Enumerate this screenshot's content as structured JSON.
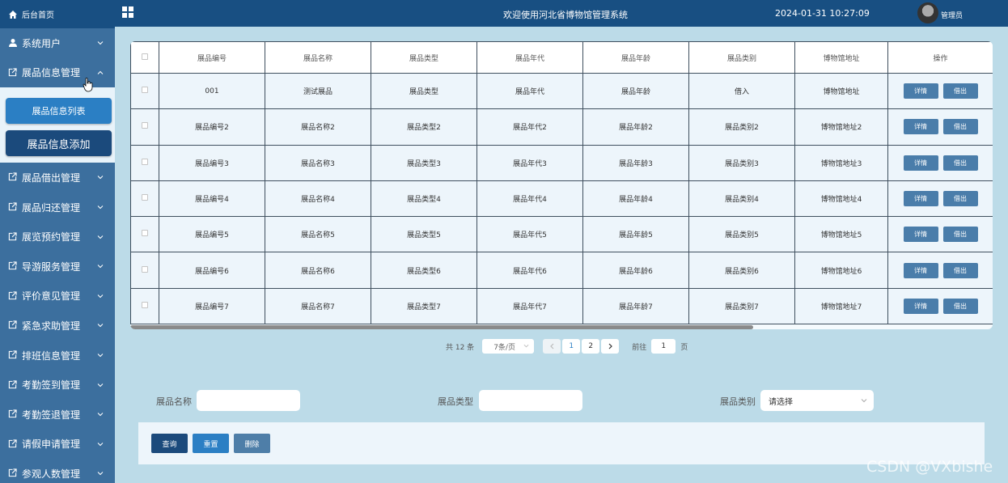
{
  "header": {
    "welcome": "欢迎使用河北省博物馆管理系统",
    "datetime": "2024-01-31 10:27:09",
    "user": "管理员"
  },
  "sidebar": {
    "home": "后台首页",
    "items": [
      {
        "label": "系统用户"
      },
      {
        "label": "展品信息管理",
        "expanded": true,
        "children": [
          "展品信息列表",
          "展品信息添加"
        ]
      },
      {
        "label": "展品借出管理"
      },
      {
        "label": "展品归还管理"
      },
      {
        "label": "展览预约管理"
      },
      {
        "label": "导游服务管理"
      },
      {
        "label": "评价意见管理"
      },
      {
        "label": "紧急求助管理"
      },
      {
        "label": "排班信息管理"
      },
      {
        "label": "考勤签到管理"
      },
      {
        "label": "考勤签退管理"
      },
      {
        "label": "请假申请管理"
      },
      {
        "label": "参观人数管理"
      }
    ]
  },
  "table": {
    "columns": [
      "展品编号",
      "展品名称",
      "展品类型",
      "展品年代",
      "展品年龄",
      "展品类别",
      "博物馆地址",
      "操作"
    ],
    "rows": [
      [
        "001",
        "测试展品",
        "展品类型",
        "展品年代",
        "展品年龄",
        "借入",
        "博物馆地址"
      ],
      [
        "展品编号2",
        "展品名称2",
        "展品类型2",
        "展品年代2",
        "展品年龄2",
        "展品类别2",
        "博物馆地址2"
      ],
      [
        "展品编号3",
        "展品名称3",
        "展品类型3",
        "展品年代3",
        "展品年龄3",
        "展品类别3",
        "博物馆地址3"
      ],
      [
        "展品编号4",
        "展品名称4",
        "展品类型4",
        "展品年代4",
        "展品年龄4",
        "展品类别4",
        "博物馆地址4"
      ],
      [
        "展品编号5",
        "展品名称5",
        "展品类型5",
        "展品年代5",
        "展品年龄5",
        "展品类别5",
        "博物馆地址5"
      ],
      [
        "展品编号6",
        "展品名称6",
        "展品类型6",
        "展品年代6",
        "展品年龄6",
        "展品类别6",
        "博物馆地址6"
      ],
      [
        "展品编号7",
        "展品名称7",
        "展品类型7",
        "展品年代7",
        "展品年龄7",
        "展品类别7",
        "博物馆地址7"
      ]
    ],
    "row_actions": [
      "详情",
      "借出"
    ]
  },
  "pagination": {
    "total": "共 12 条",
    "page_size": "7条/页",
    "pages": [
      "1",
      "2"
    ],
    "current": "1",
    "goto_label": "前往",
    "goto_value": "1",
    "page_unit": "页"
  },
  "search": {
    "name_label": "展品名称",
    "type_label": "展品类型",
    "category_label": "展品类别",
    "category_placeholder": "请选择"
  },
  "actions": {
    "query": "查询",
    "reset": "重置",
    "delete": "删除"
  },
  "watermark": "CSDN @VXbishe",
  "colors": {
    "header_bg": "#184f82",
    "sidebar_bg": "#3c6f9e",
    "content_bg": "#bcdbe8",
    "primary_button": "#2b7fc4",
    "query_button": "#1b4a7c",
    "delete_button": "#4e7ea8"
  }
}
